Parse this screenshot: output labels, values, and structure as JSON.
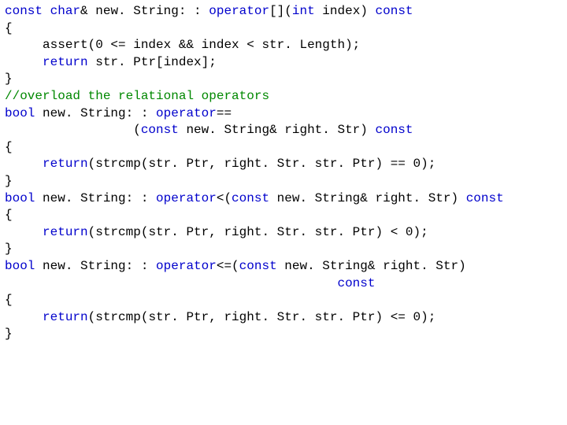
{
  "code": {
    "lines": [
      {
        "segs": [
          {
            "t": "const",
            "c": "kw"
          },
          {
            "t": " "
          },
          {
            "t": "char",
            "c": "kw"
          },
          {
            "t": "& new. String: : "
          },
          {
            "t": "operator",
            "c": "kw"
          },
          {
            "t": "[]("
          },
          {
            "t": "int",
            "c": "kw"
          },
          {
            "t": " index) "
          },
          {
            "t": "const",
            "c": "kw"
          }
        ]
      },
      {
        "segs": [
          {
            "t": "{"
          }
        ]
      },
      {
        "segs": [
          {
            "t": "     assert(0 <= index && index < str. Length);"
          }
        ]
      },
      {
        "segs": [
          {
            "t": "     "
          },
          {
            "t": "return",
            "c": "kw"
          },
          {
            "t": " str. Ptr[index];"
          }
        ]
      },
      {
        "segs": [
          {
            "t": "}"
          }
        ]
      },
      {
        "segs": [
          {
            "t": ""
          }
        ]
      },
      {
        "segs": [
          {
            "t": "//overload the relational operators",
            "c": "cm"
          }
        ]
      },
      {
        "segs": [
          {
            "t": "bool",
            "c": "kw"
          },
          {
            "t": " new. String: : "
          },
          {
            "t": "operator",
            "c": "kw"
          },
          {
            "t": "=="
          }
        ]
      },
      {
        "segs": [
          {
            "t": "                 ("
          },
          {
            "t": "const",
            "c": "kw"
          },
          {
            "t": " new. String& right. Str) "
          },
          {
            "t": "const",
            "c": "kw"
          }
        ]
      },
      {
        "segs": [
          {
            "t": "{"
          }
        ]
      },
      {
        "segs": [
          {
            "t": "     "
          },
          {
            "t": "return",
            "c": "kw"
          },
          {
            "t": "(strcmp(str. Ptr, right. Str. str. Ptr) == 0);"
          }
        ]
      },
      {
        "segs": [
          {
            "t": "}"
          }
        ]
      },
      {
        "segs": [
          {
            "t": ""
          }
        ]
      },
      {
        "segs": [
          {
            "t": "bool",
            "c": "kw"
          },
          {
            "t": " new. String: : "
          },
          {
            "t": "operator",
            "c": "kw"
          },
          {
            "t": "<("
          },
          {
            "t": "const",
            "c": "kw"
          },
          {
            "t": " new. String& right. Str) "
          },
          {
            "t": "const",
            "c": "kw"
          }
        ]
      },
      {
        "segs": [
          {
            "t": "{"
          }
        ]
      },
      {
        "segs": [
          {
            "t": "     "
          },
          {
            "t": "return",
            "c": "kw"
          },
          {
            "t": "(strcmp(str. Ptr, right. Str. str. Ptr) < 0);"
          }
        ]
      },
      {
        "segs": [
          {
            "t": "}"
          }
        ]
      },
      {
        "segs": [
          {
            "t": ""
          }
        ]
      },
      {
        "segs": [
          {
            "t": "bool",
            "c": "kw"
          },
          {
            "t": " new. String: : "
          },
          {
            "t": "operator",
            "c": "kw"
          },
          {
            "t": "<=("
          },
          {
            "t": "const",
            "c": "kw"
          },
          {
            "t": " new. String& right. Str)"
          }
        ]
      },
      {
        "segs": [
          {
            "t": "                                            "
          },
          {
            "t": "const",
            "c": "kw"
          }
        ]
      },
      {
        "segs": [
          {
            "t": "{"
          }
        ]
      },
      {
        "segs": [
          {
            "t": "     "
          },
          {
            "t": "return",
            "c": "kw"
          },
          {
            "t": "(strcmp(str. Ptr, right. Str. str. Ptr) <= 0);"
          }
        ]
      },
      {
        "segs": [
          {
            "t": "}"
          }
        ]
      }
    ]
  }
}
